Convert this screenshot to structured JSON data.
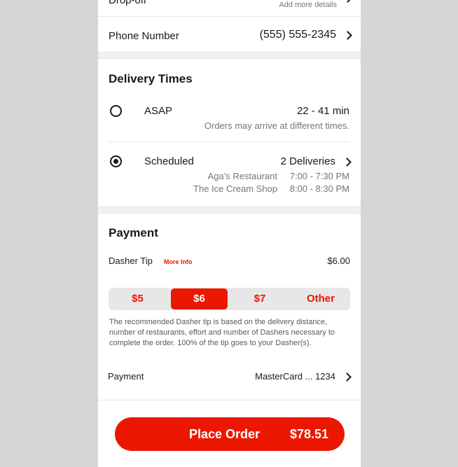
{
  "dropoff": {
    "label": "Drop-off",
    "sub": "Add more details"
  },
  "phone": {
    "label": "Phone Number",
    "value": "(555) 555-2345"
  },
  "delivery": {
    "title": "Delivery Times",
    "asap": {
      "label": "ASAP",
      "time": "22 - 41 min",
      "note": "Orders may arrive at different times."
    },
    "scheduled": {
      "label": "Scheduled",
      "value": "2 Deliveries",
      "lines": [
        {
          "store": "Aga’s Restaurant",
          "time": "7:00 - 7:30 PM"
        },
        {
          "store": "The Ice Cream Shop",
          "time": "8:00 - 8:30 PM"
        }
      ]
    }
  },
  "payment": {
    "title": "Payment",
    "tip_label": "Dasher Tip",
    "more_info": "More Info",
    "tip_value": "$6.00",
    "tip_options": [
      "$5",
      "$6",
      "$7",
      "Other"
    ],
    "selected_tip": "$6",
    "tip_note": "The recommended Dasher tip is based on the delivery distance, number of restaurants, effort and number of Dashers necessary to complete the order.  100% of the tip goes to your Dasher(s).",
    "method_label": "Payment",
    "method_value": "MasterCard ... 1234"
  },
  "cta": {
    "label": "Place Order",
    "total": "$78.51"
  },
  "colors": {
    "brand": "#eb1700",
    "text": "#191919",
    "muted": "#767676",
    "background": "#d6d6d6"
  }
}
